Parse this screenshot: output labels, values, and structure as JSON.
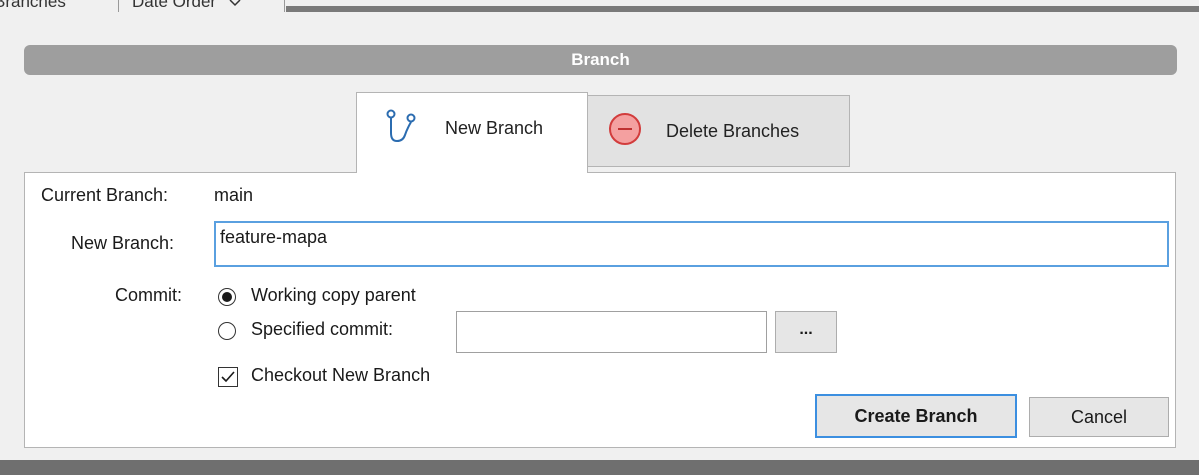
{
  "background_window": {
    "tab_label": "Branches",
    "sort_dropdown": "Date Order",
    "sort_dropdown_arrow": "chevron-down-icon"
  },
  "dialog": {
    "title": "Branch",
    "tabs": [
      {
        "label": "New Branch",
        "icon": "branch-icon",
        "selected": true
      },
      {
        "label": "Delete Branches",
        "icon": "minus-circle-icon",
        "selected": false
      }
    ],
    "current_branch_label": "Current Branch:",
    "current_branch_value": "main",
    "new_branch_label": "New Branch:",
    "new_branch_value": "feature-mapa",
    "commit_label": "Commit:",
    "commit_options": [
      {
        "label": "Working copy parent",
        "checked": true
      },
      {
        "label": "Specified commit:",
        "checked": false
      }
    ],
    "specified_commit_value": "",
    "browse_button": "...",
    "checkout_label": "Checkout New Branch",
    "checkout_checked": true,
    "create_button": "Create Branch",
    "cancel_button": "Cancel"
  },
  "colors": {
    "title_bar": "#9e9e9e",
    "focus_border": "#3c8fe0",
    "delete_icon_fill": "#f4a0a0",
    "delete_icon_stroke": "#d23c3c",
    "branch_icon": "#2b6cb0"
  }
}
